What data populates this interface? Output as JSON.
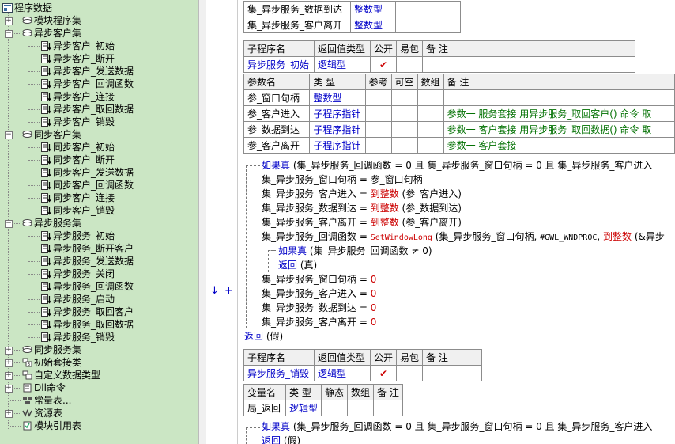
{
  "tree": {
    "root": "程序数据",
    "modules": "模块程序集",
    "async_client": {
      "label": "异步客户集",
      "items": [
        "异步客户_初始",
        "异步客户_断开",
        "异步客户_发送数据",
        "异步客户_回调函数",
        "异步客户_连接",
        "异步客户_取回数据",
        "异步客户_销毁"
      ]
    },
    "sync_client": {
      "label": "同步客户集",
      "items": [
        "同步客户_初始",
        "同步客户_断开",
        "同步客户_发送数据",
        "同步客户_回调函数",
        "同步客户_连接",
        "同步客户_销毁"
      ]
    },
    "async_server": {
      "label": "异步服务集",
      "items": [
        "异步服务_初始",
        "异步服务_断开客户",
        "异步服务_发送数据",
        "异步服务_关闭",
        "异步服务_回调函数",
        "异步服务_启动",
        "异步服务_取回客户",
        "异步服务_取回数据",
        "异步服务_销毁"
      ]
    },
    "tail": [
      "同步服务集",
      "初始套接类",
      "自定义数据类型",
      "Dll命令",
      "常量表...",
      "资源表",
      "模块引用表"
    ]
  },
  "gutter": {
    "arrow": "↓",
    "plus": "+"
  },
  "code": {
    "top_table": [
      {
        "name": "集_异步服务_数据到达",
        "type": "整数型"
      },
      {
        "name": "集_异步服务_客户离开",
        "type": "整数型"
      }
    ],
    "sub1": {
      "headers": [
        "子程序名",
        "返回值类型",
        "公开",
        "易包",
        "备 注"
      ],
      "name": "异步服务_初始",
      "ret": "逻辑型",
      "public": "✔",
      "param_headers": [
        "参数名",
        "类 型",
        "参考",
        "可空",
        "数组",
        "备 注"
      ],
      "params": [
        {
          "name": "参_窗口句柄",
          "type": "整数型",
          "note": ""
        },
        {
          "name": "参_客户进入",
          "type": "子程序指针",
          "note": "参数一 服务套接 用异步服务_取回客户() 命令 取"
        },
        {
          "name": "参_数据到达",
          "type": "子程序指针",
          "note": "参数一 客户套接 用异步服务_取回数据() 命令 取"
        },
        {
          "name": "参_客户离开",
          "type": "子程序指针",
          "note": "参数一 客户套接"
        }
      ]
    },
    "lines": {
      "if1_kw": "如果真",
      "if1_rest": " (集_异步服务_回调函数 = 0 且 集_异步服务_窗口句柄 = 0 且 集_异步服务_客户进入",
      "l1": "集_异步服务_窗口句柄 = 参_窗口句柄",
      "l2a": "集_异步服务_客户进入 = ",
      "l2b": "到整数",
      "l2c": " (参_客户进入)",
      "l3a": "集_异步服务_数据到达 = ",
      "l3b": "到整数",
      "l3c": " (参_数据到达)",
      "l4a": "集_异步服务_客户离开 = ",
      "l4b": "到整数",
      "l4c": " (参_客户离开)",
      "l5a": "集_异步服务_回调函数 = ",
      "l5b": "SetWindowLong",
      "l5c": " (集_异步服务_窗口句柄, ",
      "l5d": "#GWL_WNDPROC",
      "l5e": ", ",
      "l5f": "到整数",
      "l5g": " (&异步",
      "if2_kw": "如果真",
      "if2_rest": " (集_异步服务_回调函数 ≠ 0)",
      "ret_kw": "返回",
      "ret_true": " (真)",
      "z1": "集_异步服务_窗口句柄 = ",
      "z2": "集_异步服务_客户进入 = ",
      "z3": "集_异步服务_数据到达 = ",
      "z4": "集_异步服务_客户离开 = ",
      "zero": "0",
      "ret_false_kw": "返回",
      "ret_false": " (假)"
    },
    "sub2": {
      "headers": [
        "子程序名",
        "返回值类型",
        "公开",
        "易包",
        "备 注"
      ],
      "name": "异步服务_销毁",
      "ret": "逻辑型",
      "public": "✔"
    },
    "var_table": {
      "headers": [
        "变量名",
        "类 型",
        "静态",
        "数组",
        "备 注"
      ],
      "name": "局_返回",
      "type": "逻辑型"
    },
    "tail": {
      "if_kw": "如果真",
      "if_rest": " (集_异步服务_回调函数 = 0 且 集_异步服务_窗口句柄 = 0 且 集_异步服务_客户进入",
      "ret_kw": "返回",
      "ret_rest": " (假)"
    }
  }
}
